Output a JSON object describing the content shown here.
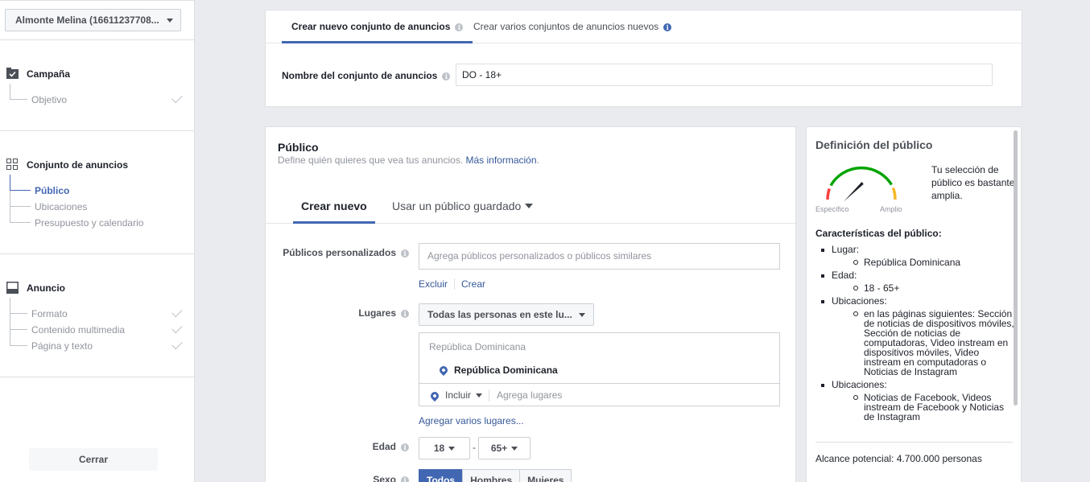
{
  "account": {
    "name": "Almonte Melina (16611237708..."
  },
  "sidebar": {
    "sections": [
      {
        "title": "Campaña",
        "items": [
          {
            "label": "Objetivo"
          }
        ]
      },
      {
        "title": "Conjunto de anuncios",
        "items": [
          {
            "label": "Público"
          },
          {
            "label": "Ubicaciones"
          },
          {
            "label": "Presupuesto y calendario"
          }
        ]
      },
      {
        "title": "Anuncio",
        "items": [
          {
            "label": "Formato"
          },
          {
            "label": "Contenido multimedia"
          },
          {
            "label": "Página y texto"
          }
        ]
      }
    ],
    "close_label": "Cerrar"
  },
  "top_card": {
    "tab_single": "Crear nuevo conjunto de anuncios",
    "tab_multi": "Crear varios conjuntos de anuncios nuevos",
    "name_label": "Nombre del conjunto de anuncios",
    "name_value": "DO - 18+"
  },
  "audience": {
    "title": "Público",
    "description": "Define quién quieres que vea tus anuncios.",
    "more_info": "Más información",
    "tab_new": "Crear nuevo",
    "tab_saved": "Usar un público guardado",
    "custom_label": "Públicos personalizados",
    "custom_placeholder": "Agrega públicos personalizados o públicos similares",
    "exclude": "Excluir",
    "create": "Crear",
    "places_label": "Lugares",
    "places_dropdown": "Todas las personas en este lu...",
    "location_header": "República Dominicana",
    "location_item": "República Dominicana",
    "include": "Incluir",
    "places_placeholder": "Agrega lugares",
    "add_multiple": "Agregar varios lugares...",
    "age_label": "Edad",
    "age_min": "18",
    "age_dash": "-",
    "age_max": "65+",
    "gender_label": "Sexo",
    "gender_options": [
      "Todos",
      "Hombres",
      "Mujeres"
    ]
  },
  "definition": {
    "title": "Definición del público",
    "gauge_left": "Específico",
    "gauge_right": "Amplio",
    "summary": "Tu selección de público es bastante amplia.",
    "characteristics_title": "Características del público:",
    "items": [
      {
        "label": "Lugar:",
        "sub": [
          "República Dominicana"
        ]
      },
      {
        "label": "Edad:",
        "sub": [
          "18 - 65+"
        ]
      },
      {
        "label": "Ubicaciones:",
        "sub": [
          "en las páginas siguientes: Sección de noticias de dispositivos móviles, Sección de noticias de computadoras, Video instream en dispositivos móviles, Video instream en computadoras o Noticias de Instagram"
        ]
      },
      {
        "label": "Ubicaciones:",
        "sub": [
          "Noticias de Facebook, Videos instream de Facebook y Noticias de Instagram"
        ]
      }
    ],
    "reach": "Alcance potencial: 4.700.000 personas"
  },
  "colors": {
    "accent": "#4267b2",
    "link": "#365899",
    "gauge_green": "#00a400",
    "gauge_red": "#fa3e3e",
    "gauge_orange": "#f7b928"
  }
}
